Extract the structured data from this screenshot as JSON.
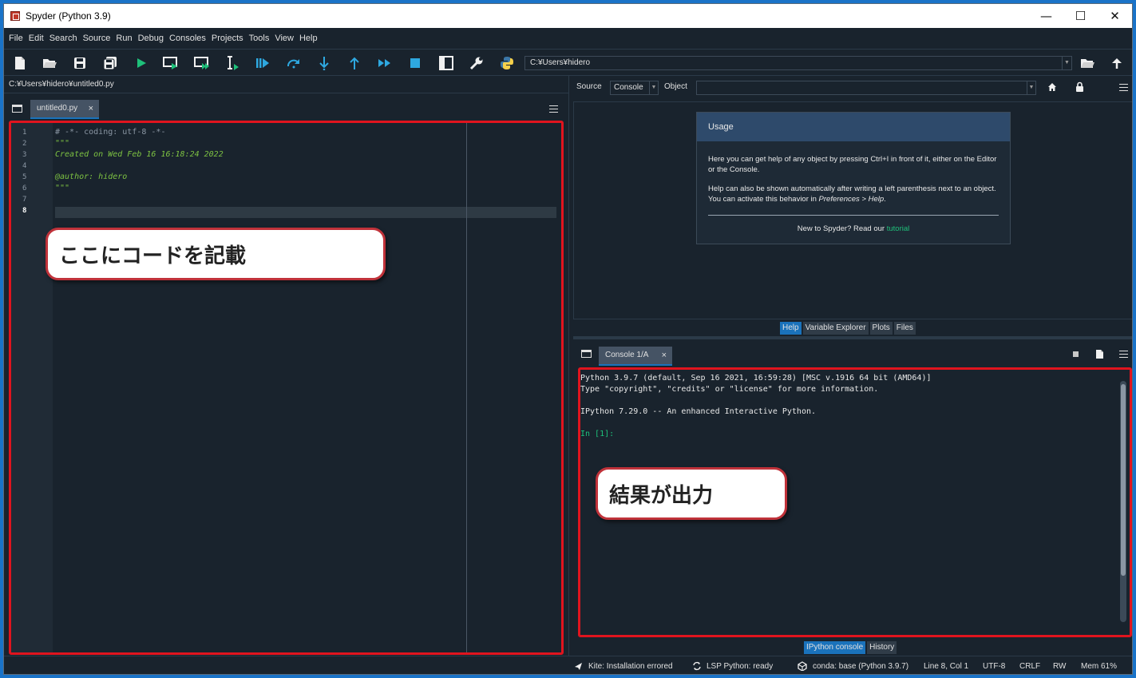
{
  "window": {
    "title": "Spyder (Python 3.9)",
    "minimize": "—",
    "maximize": "☐",
    "close": "✕"
  },
  "menubar": {
    "items": [
      "File",
      "Edit",
      "Search",
      "Source",
      "Run",
      "Debug",
      "Consoles",
      "Projects",
      "Tools",
      "View",
      "Help"
    ]
  },
  "toolbar": {
    "icons": [
      "new-file-icon",
      "open-file-icon",
      "save-icon",
      "save-all-icon",
      "run-icon",
      "run-cell-icon",
      "run-cell-advance-icon",
      "run-selection-icon",
      "debug-icon",
      "step-icon",
      "step-into-icon",
      "step-return-icon",
      "continue-icon",
      "stop-icon",
      "maximize-pane-icon",
      "preferences-icon",
      "python-path-icon"
    ],
    "working_directory": "C:¥Users¥hidero",
    "colors": {
      "blue": "#1a72bb",
      "green": "#1ec07a",
      "light_blue": "#2ea8e0"
    }
  },
  "editor": {
    "file_path": "C:¥Users¥hidero¥untitled0.py",
    "tab_label": "untitled0.py",
    "tab_close": "×",
    "lines": [
      {
        "num": "1",
        "text": "# -*- coding: utf-8 -*-",
        "kind": "comment"
      },
      {
        "num": "2",
        "text": "\"\"\"",
        "kind": "doc"
      },
      {
        "num": "3",
        "text": "Created on Wed Feb 16 16:18:24 2022",
        "kind": "doc"
      },
      {
        "num": "4",
        "text": "",
        "kind": "doc"
      },
      {
        "num": "5",
        "text": "@author: hidero",
        "kind": "doc"
      },
      {
        "num": "6",
        "text": "\"\"\"",
        "kind": "doc"
      },
      {
        "num": "7",
        "text": "",
        "kind": "doc"
      },
      {
        "num": "8",
        "text": "",
        "kind": "doc"
      }
    ],
    "current_line": "8",
    "callout": "ここにコードを記載"
  },
  "help": {
    "source_label": "Source",
    "source_value": "Console",
    "object_label": "Object",
    "object_value": "",
    "usage_title": "Usage",
    "usage_p1": "Here you can get help of any object by pressing Ctrl+I in front of it, either on the Editor or the Console.",
    "usage_p2_a": "Help can also be shown automatically after writing a left parenthesis next to an object. You can activate this behavior in ",
    "usage_p2_b": "Preferences > Help",
    "usage_p2_c": ".",
    "usage_footer_text": "New to Spyder? Read our ",
    "usage_footer_link": "tutorial",
    "tabs": [
      "Help",
      "Variable Explorer",
      "Plots",
      "Files"
    ],
    "active_tab": "Help"
  },
  "console": {
    "tab_label": "Console 1/A",
    "tab_close": "×",
    "lines": [
      "Python 3.9.7 (default, Sep 16 2021, 16:59:28) [MSC v.1916 64 bit (AMD64)]",
      "Type \"copyright\", \"credits\" or \"license\" for more information.",
      "",
      "IPython 7.29.0 -- An enhanced Interactive Python.",
      "",
      "In [1]:"
    ],
    "callout": "結果が出力",
    "tabs": [
      "IPython console",
      "History"
    ],
    "active_tab": "IPython console"
  },
  "statusbar": {
    "kite": "Kite: Installation errored",
    "lsp": "LSP Python: ready",
    "conda": "conda: base (Python 3.9.7)",
    "position": "Line 8, Col 1",
    "encoding": "UTF-8",
    "eol": "CRLF",
    "permissions": "RW",
    "memory": "Mem 61%"
  }
}
